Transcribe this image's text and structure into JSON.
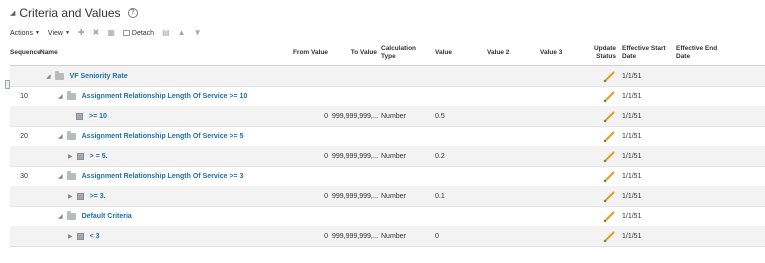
{
  "section": {
    "title": "Criteria and Values",
    "help": "?"
  },
  "toolbar": {
    "actions": "Actions",
    "view": "View",
    "detach": "Detach"
  },
  "columns": {
    "sequence": "Sequence",
    "name": "Name",
    "from_value": "From Value",
    "to_value": "To Value",
    "calc_type": "Calculation Type",
    "value": "Value",
    "value2": "Value 2",
    "value3": "Value 3",
    "update_status": "Update Status",
    "eff_start": "Effective Start Date",
    "eff_end": "Effective End Date"
  },
  "rows": [
    {
      "seq": "",
      "name": "VF Seniority Rate",
      "from": "",
      "to": "",
      "calc": "",
      "value": "",
      "start": "1/1/51"
    },
    {
      "seq": "10",
      "name": "Assignment Relationship Length Of Service >= 10",
      "from": "",
      "to": "",
      "calc": "",
      "value": "",
      "start": "1/1/51"
    },
    {
      "seq": "",
      "name": ">= 10",
      "from": "0",
      "to": "999,999,999,...",
      "calc": "Number",
      "value": "0.5",
      "start": "1/1/51"
    },
    {
      "seq": "20",
      "name": "Assignment Relationship Length Of Service >= 5",
      "from": "",
      "to": "",
      "calc": "",
      "value": "",
      "start": "1/1/51"
    },
    {
      "seq": "",
      "name": "> = 5.",
      "from": "0",
      "to": "999,999,999,...",
      "calc": "Number",
      "value": "0.2",
      "start": "1/1/51"
    },
    {
      "seq": "30",
      "name": "Assignment Relationship Length Of Service >= 3",
      "from": "",
      "to": "",
      "calc": "",
      "value": "",
      "start": "1/1/51"
    },
    {
      "seq": "",
      "name": ">= 3.",
      "from": "0",
      "to": "999,999,999,...",
      "calc": "Number",
      "value": "0.1",
      "start": "1/1/51"
    },
    {
      "seq": "",
      "name": "Default Criteria",
      "from": "",
      "to": "",
      "calc": "",
      "value": "",
      "start": "1/1/51"
    },
    {
      "seq": "",
      "name": "< 3",
      "from": "0",
      "to": "999,999,999,...",
      "calc": "Number",
      "value": "0",
      "start": "1/1/51"
    }
  ]
}
